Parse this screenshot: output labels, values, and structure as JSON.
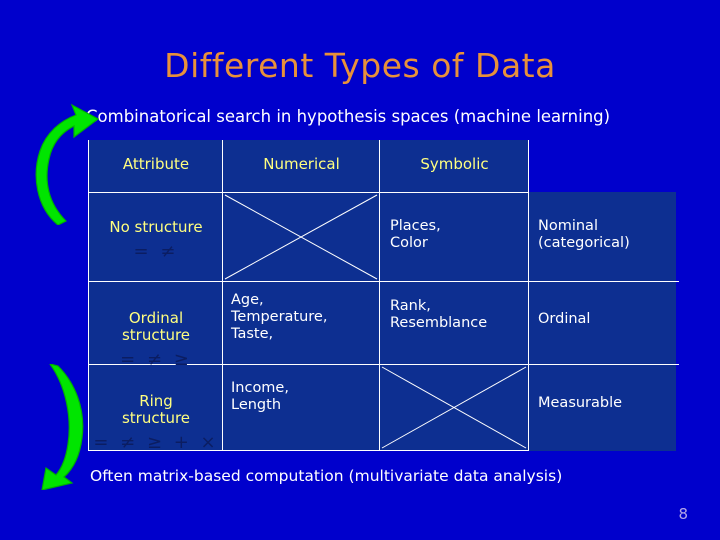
{
  "slide": {
    "title": "Different Types of Data",
    "subtitle": "Combinatorical search in hypothesis spaces (machine learning)",
    "bottom_note": "Often  matrix-based computation (multivariate data analysis)",
    "page_number": "8",
    "colors": {
      "background": "#0000cc",
      "panel": "#0d2f91",
      "title": "#e8913a",
      "header_text": "#ffff80",
      "body_text": "#ffffff",
      "operator_text": "#0b1d62",
      "border": "#ffffff",
      "arrow": "#00e500",
      "page_number": "#b3a5e8"
    }
  },
  "table": {
    "headers": [
      "Attribute",
      "Numerical",
      "Symbolic",
      ""
    ],
    "rows": [
      {
        "label": "No structure",
        "operators": "=  ≠",
        "numerical": "",
        "numerical_crossed": true,
        "symbolic": "Places,\nColor",
        "scale": "Nominal\n(categorical)"
      },
      {
        "label": "Ordinal\nstructure",
        "operators": "= ≠ ≥",
        "numerical": "Age,\nTemperature,\nTaste,",
        "numerical_crossed": false,
        "symbolic": "Rank,\nResemblance",
        "scale": "Ordinal"
      },
      {
        "label": "Ring\nstructure",
        "operators": "= ≠ ≥ + ×",
        "numerical": "Income,\nLength",
        "numerical_crossed": false,
        "symbolic": "",
        "symbolic_crossed": true,
        "scale": "Measurable"
      }
    ]
  },
  "annotations": {
    "arrow_top": "curved-green-arrow-up",
    "arrow_bottom": "curved-green-arrow-down"
  }
}
